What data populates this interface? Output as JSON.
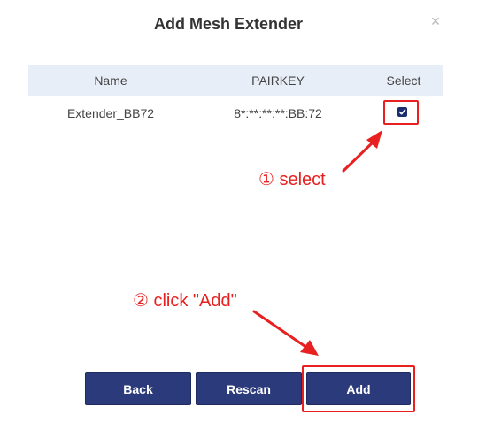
{
  "dialog": {
    "title": "Add Mesh Extender",
    "close_symbol": "×"
  },
  "table": {
    "headers": [
      "Name",
      "PAIRKEY",
      "Select"
    ],
    "rows": [
      {
        "name": "Extender_BB72",
        "pairkey": "8*:**:**:**:BB:72",
        "selected": true
      }
    ]
  },
  "annotations": {
    "step1": "① select",
    "step2": "② click \"Add\"",
    "color": "#e82020"
  },
  "buttons": {
    "back": "Back",
    "rescan": "Rescan",
    "add": "Add",
    "color": "#2b3a7a"
  }
}
